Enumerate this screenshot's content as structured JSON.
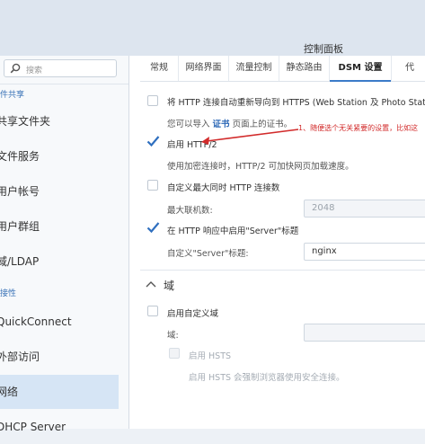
{
  "window": {
    "title": "控制面板"
  },
  "sidebar": {
    "search_placeholder": "搜索",
    "items": [
      {
        "label": "件共享",
        "type": "group"
      },
      {
        "label": "共享文件夹",
        "type": "item"
      },
      {
        "label": "文件服务",
        "type": "item"
      },
      {
        "label": "用户帐号",
        "type": "item"
      },
      {
        "label": "用户群组",
        "type": "item"
      },
      {
        "label": "域/LDAP",
        "type": "item"
      },
      {
        "label": "接性",
        "type": "group"
      },
      {
        "label": "QuickConnect",
        "type": "item"
      },
      {
        "label": "外部访问",
        "type": "item"
      },
      {
        "label": "网络",
        "type": "item",
        "active": true
      },
      {
        "label": "DHCP Server",
        "type": "item"
      }
    ]
  },
  "tabs": [
    {
      "label": "常规"
    },
    {
      "label": "网络界面"
    },
    {
      "label": "流量控制"
    },
    {
      "label": "静态路由"
    },
    {
      "label": "DSM 设置",
      "active": true
    },
    {
      "label": "代"
    }
  ],
  "settings": {
    "https_redirect": {
      "label": "将 HTTP 连接自动重新导向到 HTTPS (Web Station 及 Photo Stat",
      "checked": false
    },
    "cert_prefix": "您可以导入",
    "cert_link": "证书",
    "cert_suffix": "页面上的证书。",
    "http2": {
      "label": "启用 HTTP/2",
      "checked": true
    },
    "http2_desc": "使用加密连接时，HTTP/2 可加快网页加载速度。",
    "max_conn": {
      "label": "自定义最大同时 HTTP 连接数",
      "checked": false
    },
    "max_conn_field_label": "最大联机数:",
    "max_conn_value": "2048",
    "server_header": {
      "label": "在 HTTP 响应中启用\"Server\"标题",
      "checked": true
    },
    "server_header_field_label": "自定义\"Server\"标题:",
    "server_header_value": "nginx"
  },
  "domain_section": {
    "title": "域",
    "custom_domain": {
      "label": "启用自定义域",
      "checked": false
    },
    "domain_field_label": "域:",
    "domain_value": "",
    "hsts": {
      "label": "启用 HSTS",
      "checked": false,
      "disabled": true
    },
    "hsts_desc": "启用 HSTS 会强制浏览器使用安全连接。"
  },
  "annotation": {
    "text": "1、随便选个无关紧要的设置，比如这",
    "color": "#d22b2b"
  },
  "colors": {
    "accent": "#3b7bc8",
    "sidebar_active": "#d6e5f5",
    "check": "#2f6fbf"
  }
}
